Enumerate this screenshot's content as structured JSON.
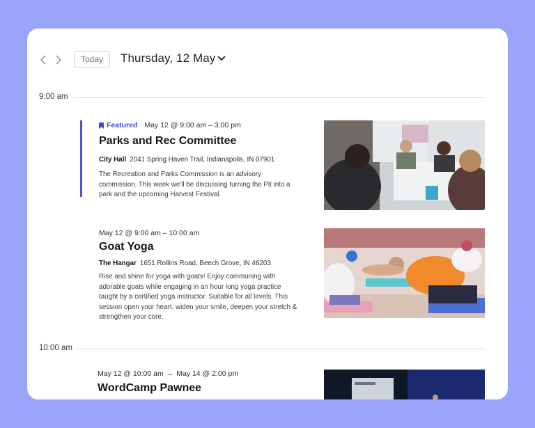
{
  "toolbar": {
    "prev_icon": "chevron-left-icon",
    "next_icon": "chevron-right-icon",
    "today_label": "Today",
    "date_title": "Thursday, 12 May",
    "dropdown_icon": "chevron-down-icon"
  },
  "time_slots": [
    {
      "label": "9:00 am"
    },
    {
      "label": "10:00 am"
    }
  ],
  "events": [
    {
      "featured_label": "Featured",
      "date": "May 12 @ 9:00 am – 3:00 pm",
      "title": "Parks and Rec Committee",
      "venue_name": "City Hall",
      "venue_address": "2041 Spring Haven Trail, Indianapolis, IN 07901",
      "description": "The Recreation and Parks Commission is an advisory commission. This week we'll be discussing turning the Pit into a park and the upcoming Harvest Festival."
    },
    {
      "date": "May 12 @ 9:00 am – 10:00 am",
      "title": "Goat Yoga",
      "venue_name": "The Hangar",
      "venue_address": "1651 Rollins Road, Beech Grove, IN 46203",
      "description": "Rise and shine for yoga with goats! Enjoy communing with adorable goats while engaging in an hour long yoga practice taught by a certified yoga instructor. Suitable for all levels. This session open your heart, widen your smile, deepen your stretch & strengthen your core."
    },
    {
      "date_start": "May 12 @ 10:00 am",
      "date_end": "May 14 @ 2:00 pm",
      "title": "WordCamp Pawnee"
    }
  ],
  "colors": {
    "background": "#9aa5f9",
    "accent": "#4a55d6",
    "featured_text": "#3f4bd2"
  }
}
